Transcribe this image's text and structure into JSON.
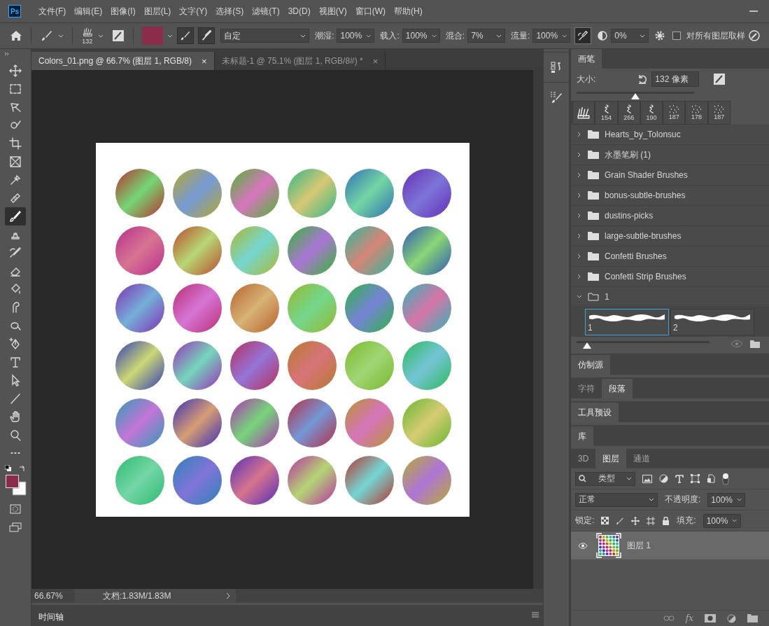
{
  "app": {
    "logo": "Ps"
  },
  "menu": [
    "文件(F)",
    "编辑(E)",
    "图像(I)",
    "图层(L)",
    "文字(Y)",
    "选择(S)",
    "滤镜(T)",
    "3D(D)",
    "视图(V)",
    "窗口(W)",
    "帮助(H)"
  ],
  "options_bar": {
    "brush_size": "132",
    "color": "#8b2c4a",
    "mode": "自定",
    "fields": [
      {
        "label": "潮湿:",
        "value": "100%"
      },
      {
        "label": "载入:",
        "value": "100%"
      },
      {
        "label": "混合:",
        "value": "7%"
      },
      {
        "label": "流量:",
        "value": "100%"
      }
    ],
    "airbrush_on": true,
    "smoothing": "0%",
    "sample_all": {
      "label": "对所有图层取样",
      "checked": false
    }
  },
  "tabs": [
    {
      "label": "Colors_01.png @ 66.7% (图层 1, RGB/8)",
      "close": "×",
      "selected": true
    },
    {
      "label": "未标题-1 @ 75.1% (图层 1, RGB/8#) *",
      "close": "×",
      "selected": false
    }
  ],
  "tools": [
    {
      "kind": "move",
      "selected": false
    },
    {
      "kind": "marquee",
      "selected": false
    },
    {
      "kind": "lasso",
      "selected": false
    },
    {
      "kind": "quick-select",
      "selected": false
    },
    {
      "kind": "crop",
      "selected": false
    },
    {
      "kind": "frame",
      "selected": false
    },
    {
      "kind": "eyedropper",
      "selected": false
    },
    {
      "kind": "healing",
      "selected": false
    },
    {
      "kind": "brush",
      "selected": true
    },
    {
      "kind": "stamp",
      "selected": false
    },
    {
      "kind": "history-brush",
      "selected": false
    },
    {
      "kind": "eraser",
      "selected": false
    },
    {
      "kind": "bucket",
      "selected": false
    },
    {
      "kind": "smudge",
      "selected": false
    },
    {
      "kind": "dodge",
      "selected": false
    },
    {
      "kind": "pen",
      "selected": false
    },
    {
      "kind": "type",
      "selected": false
    },
    {
      "kind": "path-select",
      "selected": false
    },
    {
      "kind": "line",
      "selected": false
    },
    {
      "kind": "hand",
      "selected": false
    },
    {
      "kind": "zoom",
      "selected": false
    },
    {
      "kind": "more",
      "selected": false
    }
  ],
  "colors": {
    "foreground": {
      "color": "#8b2c4a"
    },
    "background": {
      "color": "#ffffff"
    }
  },
  "status_bar": {
    "zoom": "66.67%",
    "document": "文档:1.83M/1.83M"
  },
  "timeline": {
    "tab": "时间轴"
  },
  "brush_panel": {
    "tab": "画笔",
    "size_label": "大小:",
    "size_value": "132 像素",
    "level": 0.5,
    "recent": [
      {
        "kind": "splat"
      },
      {
        "kind": "swirl",
        "size": "154"
      },
      {
        "kind": "swirl",
        "size": "266"
      },
      {
        "kind": "swirl",
        "size": "190"
      },
      {
        "kind": "dots",
        "size": "187"
      },
      {
        "kind": "dots",
        "size": "178"
      },
      {
        "kind": "dots",
        "size": "187"
      }
    ],
    "groups": [
      {
        "name": "Hearts_by_Tolonsuc",
        "expanded": false
      },
      {
        "name": "水墨笔刷 (1)",
        "expanded": false
      },
      {
        "name": "Grain Shader Brushes",
        "expanded": false
      },
      {
        "name": "bonus-subtle-brushes",
        "expanded": false
      },
      {
        "name": "dustins-picks",
        "expanded": false
      },
      {
        "name": "large-subtle-brushes",
        "expanded": false
      },
      {
        "name": "Confetti Brushes",
        "expanded": false
      },
      {
        "name": "Confetti Strip Brushes",
        "expanded": false
      },
      {
        "name": "1",
        "expanded": true,
        "brushes": [
          {
            "name": "1",
            "selected": true
          },
          {
            "name": "2",
            "selected": false
          }
        ]
      }
    ],
    "preview": {
      "level": 0.08
    }
  },
  "panel_groups": [
    {
      "tabs": [
        {
          "label": "仿制源",
          "selected": true
        }
      ]
    },
    {
      "tabs": [
        {
          "label": "字符",
          "selected": false
        },
        {
          "label": "段落",
          "selected": true
        }
      ]
    },
    {
      "tabs": [
        {
          "label": "工具预设",
          "selected": true
        }
      ]
    },
    {
      "tabs": [
        {
          "label": "库",
          "selected": true
        }
      ]
    }
  ],
  "layers_panel": {
    "tabs": [
      {
        "label": "3D",
        "selected": false
      },
      {
        "label": "图层",
        "selected": true
      },
      {
        "label": "通道",
        "selected": false
      }
    ],
    "filter": "类型",
    "blend": "正常",
    "opacity_label": "不透明度:",
    "opacity": "100%",
    "lock_label": "锁定:",
    "fill_label": "填充:",
    "fill": "100%",
    "layers": [
      {
        "name": "图层 1",
        "visible": true,
        "selected": true
      }
    ],
    "fx": "fx"
  }
}
